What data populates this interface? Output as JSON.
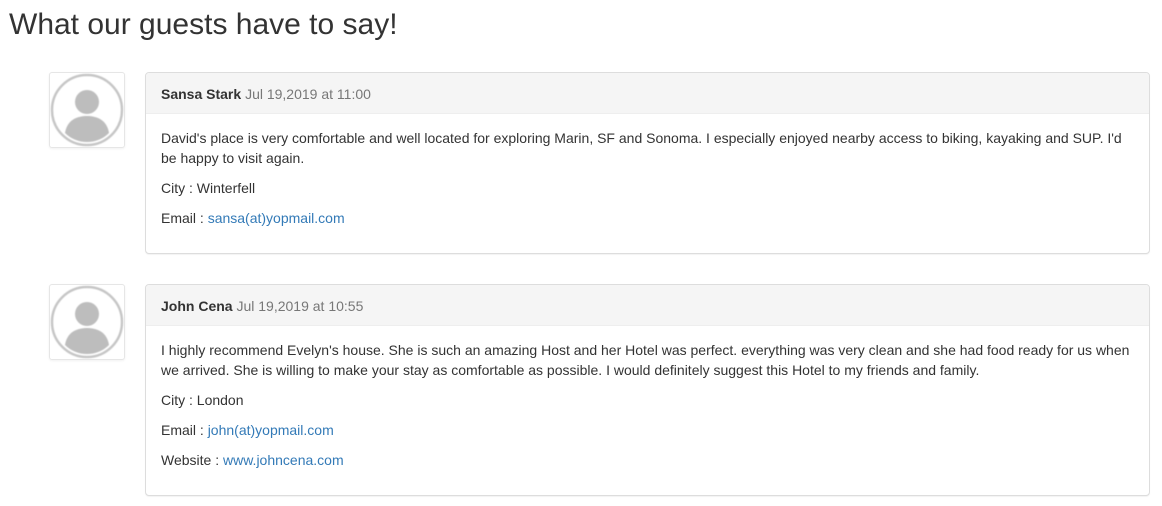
{
  "page": {
    "title": "What our guests have to say!"
  },
  "reviews": [
    {
      "author": "Sansa Stark",
      "date": "Jul 19,2019 at 11:00",
      "text": "David's place is very comfortable and well located for exploring Marin, SF and Sonoma. I especially enjoyed nearby access to biking, kayaking and SUP. I'd be happy to visit again.",
      "city_label": "City : ",
      "city": "Winterfell",
      "email_label": "Email : ",
      "email": "sansa(at)yopmail.com"
    },
    {
      "author": "John Cena",
      "date": "Jul 19,2019 at 10:55",
      "text": "I highly recommend Evelyn's house. She is such an amazing Host and her Hotel was perfect. everything was very clean and she had food ready for us when we arrived. She is willing to make your stay as comfortable as possible. I would definitely suggest this Hotel to my friends and family.",
      "city_label": "City : ",
      "city": "London",
      "email_label": "Email : ",
      "email": "john(at)yopmail.com",
      "website_label": "Website : ",
      "website": "www.johncena.com"
    }
  ],
  "colors": {
    "link": "#337ab7",
    "panel_heading_bg": "#f5f5f5",
    "muted_text": "#777777"
  },
  "icons": {
    "avatar": "user-avatar-icon"
  }
}
